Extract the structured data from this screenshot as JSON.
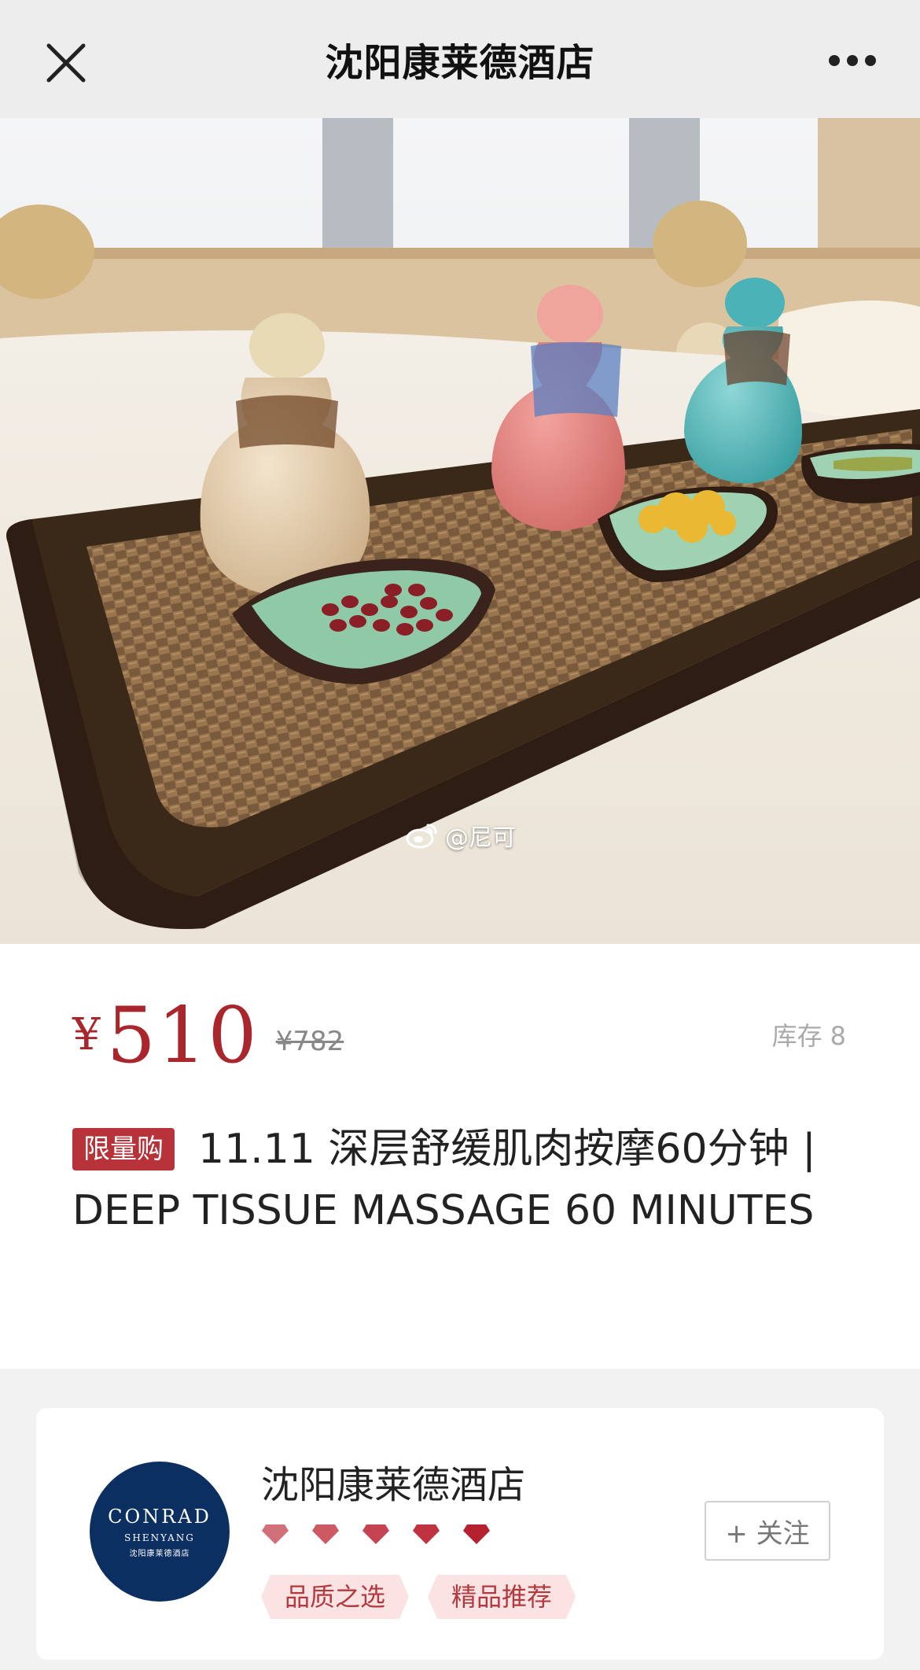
{
  "header": {
    "title": "沈阳康莱德酒店",
    "close_icon": "close-icon",
    "more_icon": "more-dots-icon"
  },
  "hero": {
    "watermark": "@尼可",
    "watermark_icon": "weibo-icon"
  },
  "product": {
    "currency": "¥",
    "price": "510",
    "original_price": "¥782",
    "stock_label": "库存",
    "stock_count": "8",
    "badge": "限量购",
    "title": "11.11 深层舒缓肌肉按摩60分钟 | DEEP TISSUE MASSAGE 60 MINUTES"
  },
  "shop": {
    "name": "沈阳康莱德酒店",
    "logo": {
      "name": "CONRAD",
      "city": "SHENYANG",
      "cn": "沈阳康莱德酒店"
    },
    "rating_diamonds": 5,
    "tags": [
      "品质之选",
      "精品推荐"
    ],
    "follow_label": "+ 关注"
  },
  "colors": {
    "accent": "#a8262c",
    "badge": "#b8323a",
    "logo_bg": "#0c2f62",
    "tag_bg": "#fbe3e3"
  }
}
